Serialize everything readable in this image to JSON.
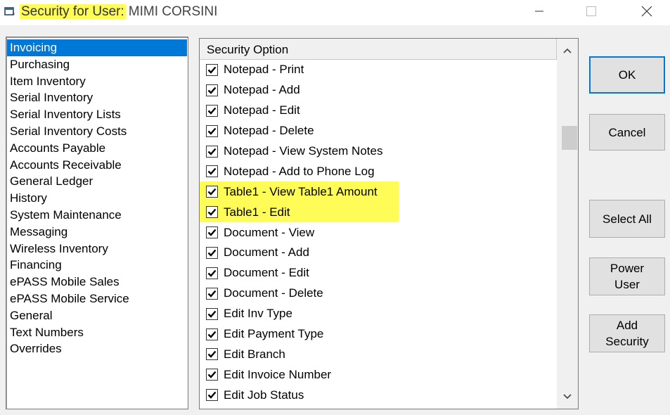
{
  "window": {
    "title_prefix": "Security for User:",
    "user_name": "MIMI CORSINI",
    "highlight_color": "#fffb57"
  },
  "categories": {
    "items": [
      "Invoicing",
      "Purchasing",
      "Item Inventory",
      "Serial Inventory",
      "Serial Inventory Lists",
      "Serial Inventory Costs",
      "Accounts Payable",
      "Accounts Receivable",
      "General Ledger",
      "History",
      "System Maintenance",
      "Messaging",
      "Wireless Inventory",
      "Financing",
      "ePASS Mobile Sales",
      "ePASS Mobile Service",
      "General",
      "Text Numbers",
      "Overrides"
    ],
    "selected": "Invoicing",
    "selected_color": "#0078d7"
  },
  "options": {
    "header": "Security Option",
    "rows": [
      {
        "label": "Notepad - Print",
        "checked": true,
        "highlighted": false
      },
      {
        "label": "Notepad - Add",
        "checked": true,
        "highlighted": false
      },
      {
        "label": "Notepad - Edit",
        "checked": true,
        "highlighted": false
      },
      {
        "label": "Notepad - Delete",
        "checked": true,
        "highlighted": false
      },
      {
        "label": "Notepad - View System Notes",
        "checked": true,
        "highlighted": false
      },
      {
        "label": "Notepad - Add to Phone Log",
        "checked": true,
        "highlighted": false
      },
      {
        "label": "Table1 - View Table1 Amount",
        "checked": true,
        "highlighted": true
      },
      {
        "label": "Table1 - Edit",
        "checked": true,
        "highlighted": true
      },
      {
        "label": "Document - View",
        "checked": true,
        "highlighted": false
      },
      {
        "label": "Document - Add",
        "checked": true,
        "highlighted": false
      },
      {
        "label": "Document - Edit",
        "checked": true,
        "highlighted": false
      },
      {
        "label": "Document - Delete",
        "checked": true,
        "highlighted": false
      },
      {
        "label": "Edit Inv Type",
        "checked": true,
        "highlighted": false
      },
      {
        "label": "Edit Payment Type",
        "checked": true,
        "highlighted": false
      },
      {
        "label": "Edit Branch",
        "checked": true,
        "highlighted": false
      },
      {
        "label": "Edit Invoice Number",
        "checked": true,
        "highlighted": false
      },
      {
        "label": "Edit Job Status",
        "checked": true,
        "highlighted": false
      }
    ]
  },
  "buttons": {
    "ok": "OK",
    "cancel": "Cancel",
    "select_all": "Select All",
    "power_user_line1": "Power",
    "power_user_line2": "User",
    "add_security_line1": "Add",
    "add_security_line2": "Security"
  },
  "icons": {
    "app": "app-window-icon",
    "minimize": "minimize-icon",
    "maximize": "maximize-icon",
    "close": "close-icon",
    "scroll_up": "chevron-up-icon",
    "scroll_down": "chevron-down-icon",
    "check": "check-icon"
  }
}
